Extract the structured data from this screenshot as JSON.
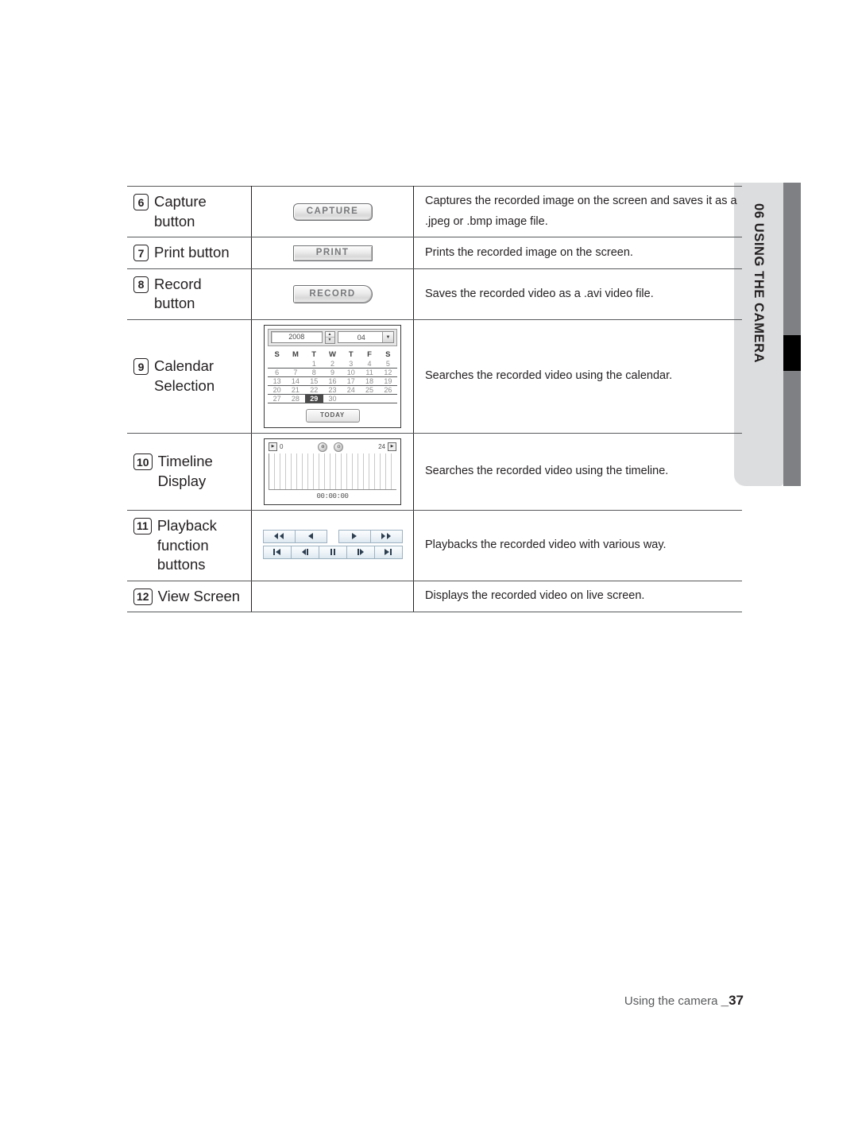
{
  "side_tab": {
    "chapter_number": "06",
    "chapter_title": "USING THE CAMERA",
    "label": "06  USING THE CAMERA"
  },
  "table": {
    "rows": [
      {
        "badge": "6",
        "label": "Capture button",
        "visual": "capture-button",
        "button_text": "CAPTURE",
        "description": "Captures the recorded image on the screen and saves it as a .jpeg or .bmp image file."
      },
      {
        "badge": "7",
        "label": "Print button",
        "visual": "print-button",
        "button_text": "PRINT",
        "description": "Prints the recorded image on the screen."
      },
      {
        "badge": "8",
        "label": "Record button",
        "visual": "record-button",
        "button_text": "RECORD",
        "description": "Saves the recorded video as a .avi video file."
      },
      {
        "badge": "9",
        "label": "Calendar Selection",
        "visual": "calendar-widget",
        "description": "Searches the recorded video using the calendar."
      },
      {
        "badge": "10",
        "label": "Timeline Display",
        "visual": "timeline-widget",
        "description": "Searches the recorded video using the timeline."
      },
      {
        "badge": "11",
        "label": "Playback function buttons",
        "visual": "playback-buttons",
        "description": "Playbacks the recorded video with various way."
      },
      {
        "badge": "12",
        "label": "View Screen",
        "visual": "none",
        "description": "Displays the recorded video on live screen."
      }
    ]
  },
  "calendar": {
    "year": "2008",
    "month": "04",
    "weekday_headers": [
      "S",
      "M",
      "T",
      "W",
      "T",
      "F",
      "S"
    ],
    "weeks": [
      [
        "",
        "",
        "1",
        "2",
        "3",
        "4",
        "5"
      ],
      [
        "6",
        "7",
        "8",
        "9",
        "10",
        "11",
        "12"
      ],
      [
        "13",
        "14",
        "15",
        "16",
        "17",
        "18",
        "19"
      ],
      [
        "20",
        "21",
        "22",
        "23",
        "24",
        "25",
        "26"
      ],
      [
        "27",
        "28",
        "29",
        "30",
        "",
        "",
        ""
      ]
    ],
    "selected_day": "29",
    "today_button": "TODAY",
    "spinner_up": "▲",
    "spinner_down": "▼",
    "dropdown_arrow": "▼"
  },
  "timeline": {
    "start_hour": "0",
    "end_hour": "24",
    "time_display": "00:00:00",
    "left_arrow": "▶",
    "right_arrow": "▶",
    "zoom_in": "⊕",
    "zoom_out": "⊖"
  },
  "playback": {
    "row1": [
      {
        "name": "rewind-button",
        "glyph": "rewind"
      },
      {
        "name": "reverse-play-button",
        "glyph": "play-left"
      },
      {
        "name": "play-button",
        "glyph": "play-right"
      },
      {
        "name": "fast-forward-button",
        "glyph": "forward"
      }
    ],
    "row2": [
      {
        "name": "skip-to-start-button",
        "glyph": "skip-start"
      },
      {
        "name": "step-backward-button",
        "glyph": "step-back"
      },
      {
        "name": "pause-button",
        "glyph": "pause"
      },
      {
        "name": "step-forward-button",
        "glyph": "step-fwd"
      },
      {
        "name": "skip-to-end-button",
        "glyph": "skip-end"
      }
    ]
  },
  "footer": {
    "text": "Using the camera ",
    "page_number": "_37"
  },
  "colors": {
    "tab_bg": "#dcdddf",
    "tab_bar": "#7e8083",
    "tab_marker": "#000000",
    "rule": "#58595b",
    "text": "#231f20"
  }
}
